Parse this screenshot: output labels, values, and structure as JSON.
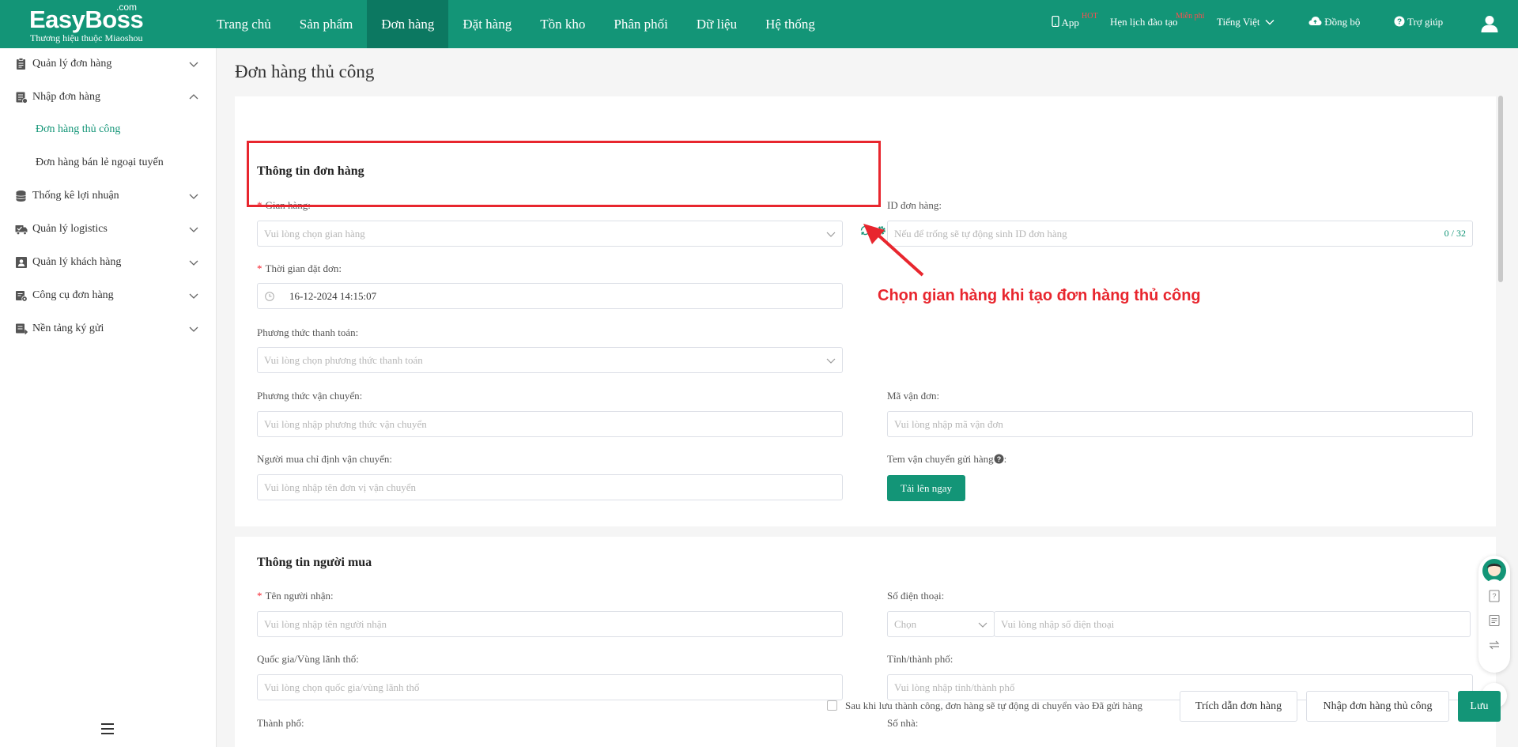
{
  "header": {
    "logo_text": "EasyBoss",
    "logo_com": ".com",
    "logo_sub": "Thương hiệu thuộc Miaoshou",
    "nav": [
      "Trang chủ",
      "Sản phẩm",
      "Đơn hàng",
      "Đặt hàng",
      "Tồn kho",
      "Phân phối",
      "Dữ liệu",
      "Hệ thống"
    ],
    "active_nav": "Đơn hàng",
    "right": {
      "app": "App",
      "app_badge": "HOT",
      "training": "Hẹn lịch đào tạo",
      "training_badge": "Miễn phí",
      "language": "Tiếng Việt",
      "sync": "Đồng bộ",
      "help": "Trợ giúp"
    }
  },
  "sidebar": {
    "items": [
      {
        "label": "Quản lý đơn hàng",
        "icon": "clipboard-icon",
        "expanded": false
      },
      {
        "label": "Nhập đơn hàng",
        "icon": "order-import-icon",
        "expanded": true
      },
      {
        "label": "Thống kê lợi nhuận",
        "icon": "database-icon",
        "expanded": false
      },
      {
        "label": "Quản lý logistics",
        "icon": "truck-icon",
        "expanded": false
      },
      {
        "label": "Quản lý khách hàng",
        "icon": "contact-icon",
        "expanded": false
      },
      {
        "label": "Công cụ đơn hàng",
        "icon": "tool-icon",
        "expanded": false
      },
      {
        "label": "Nền tảng ký gửi",
        "icon": "platform-icon",
        "expanded": false
      }
    ],
    "sub_items": [
      "Đơn hàng thủ công",
      "Đơn hàng bán lẻ ngoại tuyến"
    ],
    "active_sub": "Đơn hàng thủ công"
  },
  "page": {
    "title": "Đơn hàng thủ công"
  },
  "order_info": {
    "title": "Thông tin đơn hàng",
    "store_label": "Gian hàng:",
    "store_placeholder": "Vui lòng chọn gian hàng",
    "order_id_label": "ID đơn hàng:",
    "order_id_placeholder": "Nếu để trống sẽ tự động sinh ID đơn hàng",
    "order_id_counter": "0 / 32",
    "order_time_label": "Thời gian đặt đơn:",
    "order_time_value": "16-12-2024 14:15:07",
    "payment_label": "Phương thức thanh toán:",
    "payment_placeholder": "Vui lòng chọn phương thức thanh toán",
    "shipping_label": "Phương thức vận chuyển:",
    "shipping_placeholder": "Vui lòng nhập phương thức vận chuyển",
    "tracking_label": "Mã vận đơn:",
    "tracking_placeholder": "Vui lòng nhập mã vận đơn",
    "carrier_label": "Người mua chỉ định vận chuyển:",
    "carrier_placeholder": "Vui lòng nhập tên đơn vị vận chuyển",
    "label_upload_label": "Tem vận chuyển gửi hàng",
    "label_upload_colon": ":",
    "upload_button": "Tải lên ngay"
  },
  "annotation": {
    "text": "Chọn gian hàng khi tạo đơn hàng thủ công"
  },
  "buyer_info": {
    "title": "Thông tin người mua",
    "recipient_label": "Tên người nhận:",
    "recipient_placeholder": "Vui lòng nhập tên người nhận",
    "phone_label": "Số điện thoại:",
    "phone_code_placeholder": "Chọn",
    "phone_placeholder": "Vui lòng nhập số điện thoại",
    "country_label": "Quốc gia/Vùng lãnh thổ:",
    "country_placeholder": "Vui lòng chọn quốc gia/vùng lãnh thổ",
    "province_label": "Tỉnh/thành phố:",
    "province_placeholder": "Vui lòng nhập tỉnh/thành phố",
    "city_label": "Thành phố:",
    "house_label": "Số nhà:"
  },
  "footer": {
    "auto_move_text": "Sau khi lưu thành công, đơn hàng sẽ tự động di chuyển vào Đã gửi hàng",
    "quote_button": "Trích dẫn đơn hàng",
    "import_button": "Nhập đơn hàng thủ công",
    "save_button": "Lưu"
  },
  "colors": {
    "brand": "#139577",
    "brand_dark": "#0c7861",
    "annotation": "#e8262e",
    "required": "#f5222d"
  }
}
